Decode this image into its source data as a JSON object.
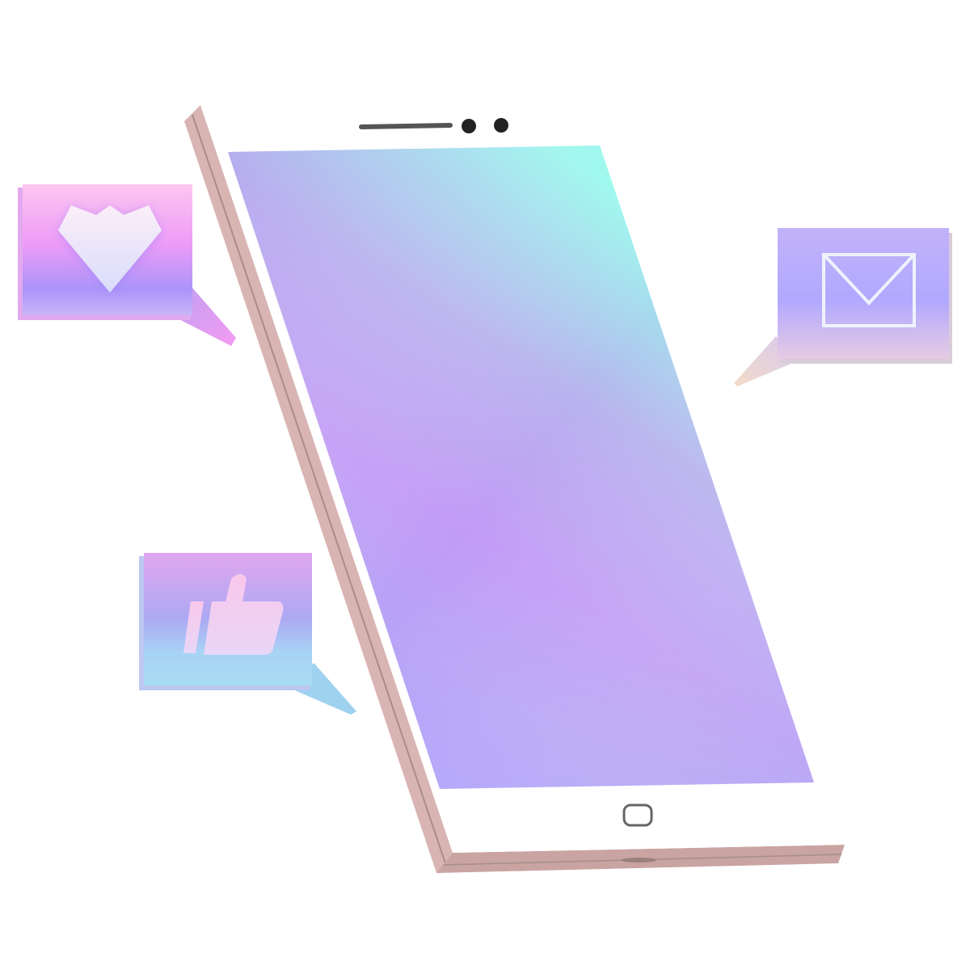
{
  "illustration": {
    "subject": "smartphone",
    "colors": {
      "background": "#ffffff",
      "phone_body": "#ffffff",
      "phone_edge": "#d8b4b2",
      "phone_edge_dark": "#c9a4a2",
      "phone_edge_line": "#a88d8a",
      "earpiece": "#555555",
      "camera": "#222222",
      "home_button": "#666666",
      "screen_teal": "#98fced",
      "screen_lilac": "#b9b3f0",
      "screen_purple": "#c79af8",
      "screen_violet": "#a99bfe",
      "screen_blue": "#aebff3"
    },
    "bubbles": [
      {
        "icon": "heart-icon",
        "gradient": [
          "#fdc6f0",
          "#ee9cf7",
          "#ab94f9"
        ]
      },
      {
        "icon": "thumbs-up-icon",
        "gradient": [
          "#e0a6ef",
          "#aca9f3",
          "#a8dcf4"
        ]
      },
      {
        "icon": "envelope-icon",
        "gradient": [
          "#c2b2f8",
          "#b1a8ff",
          "#e6cbe3"
        ]
      }
    ]
  }
}
